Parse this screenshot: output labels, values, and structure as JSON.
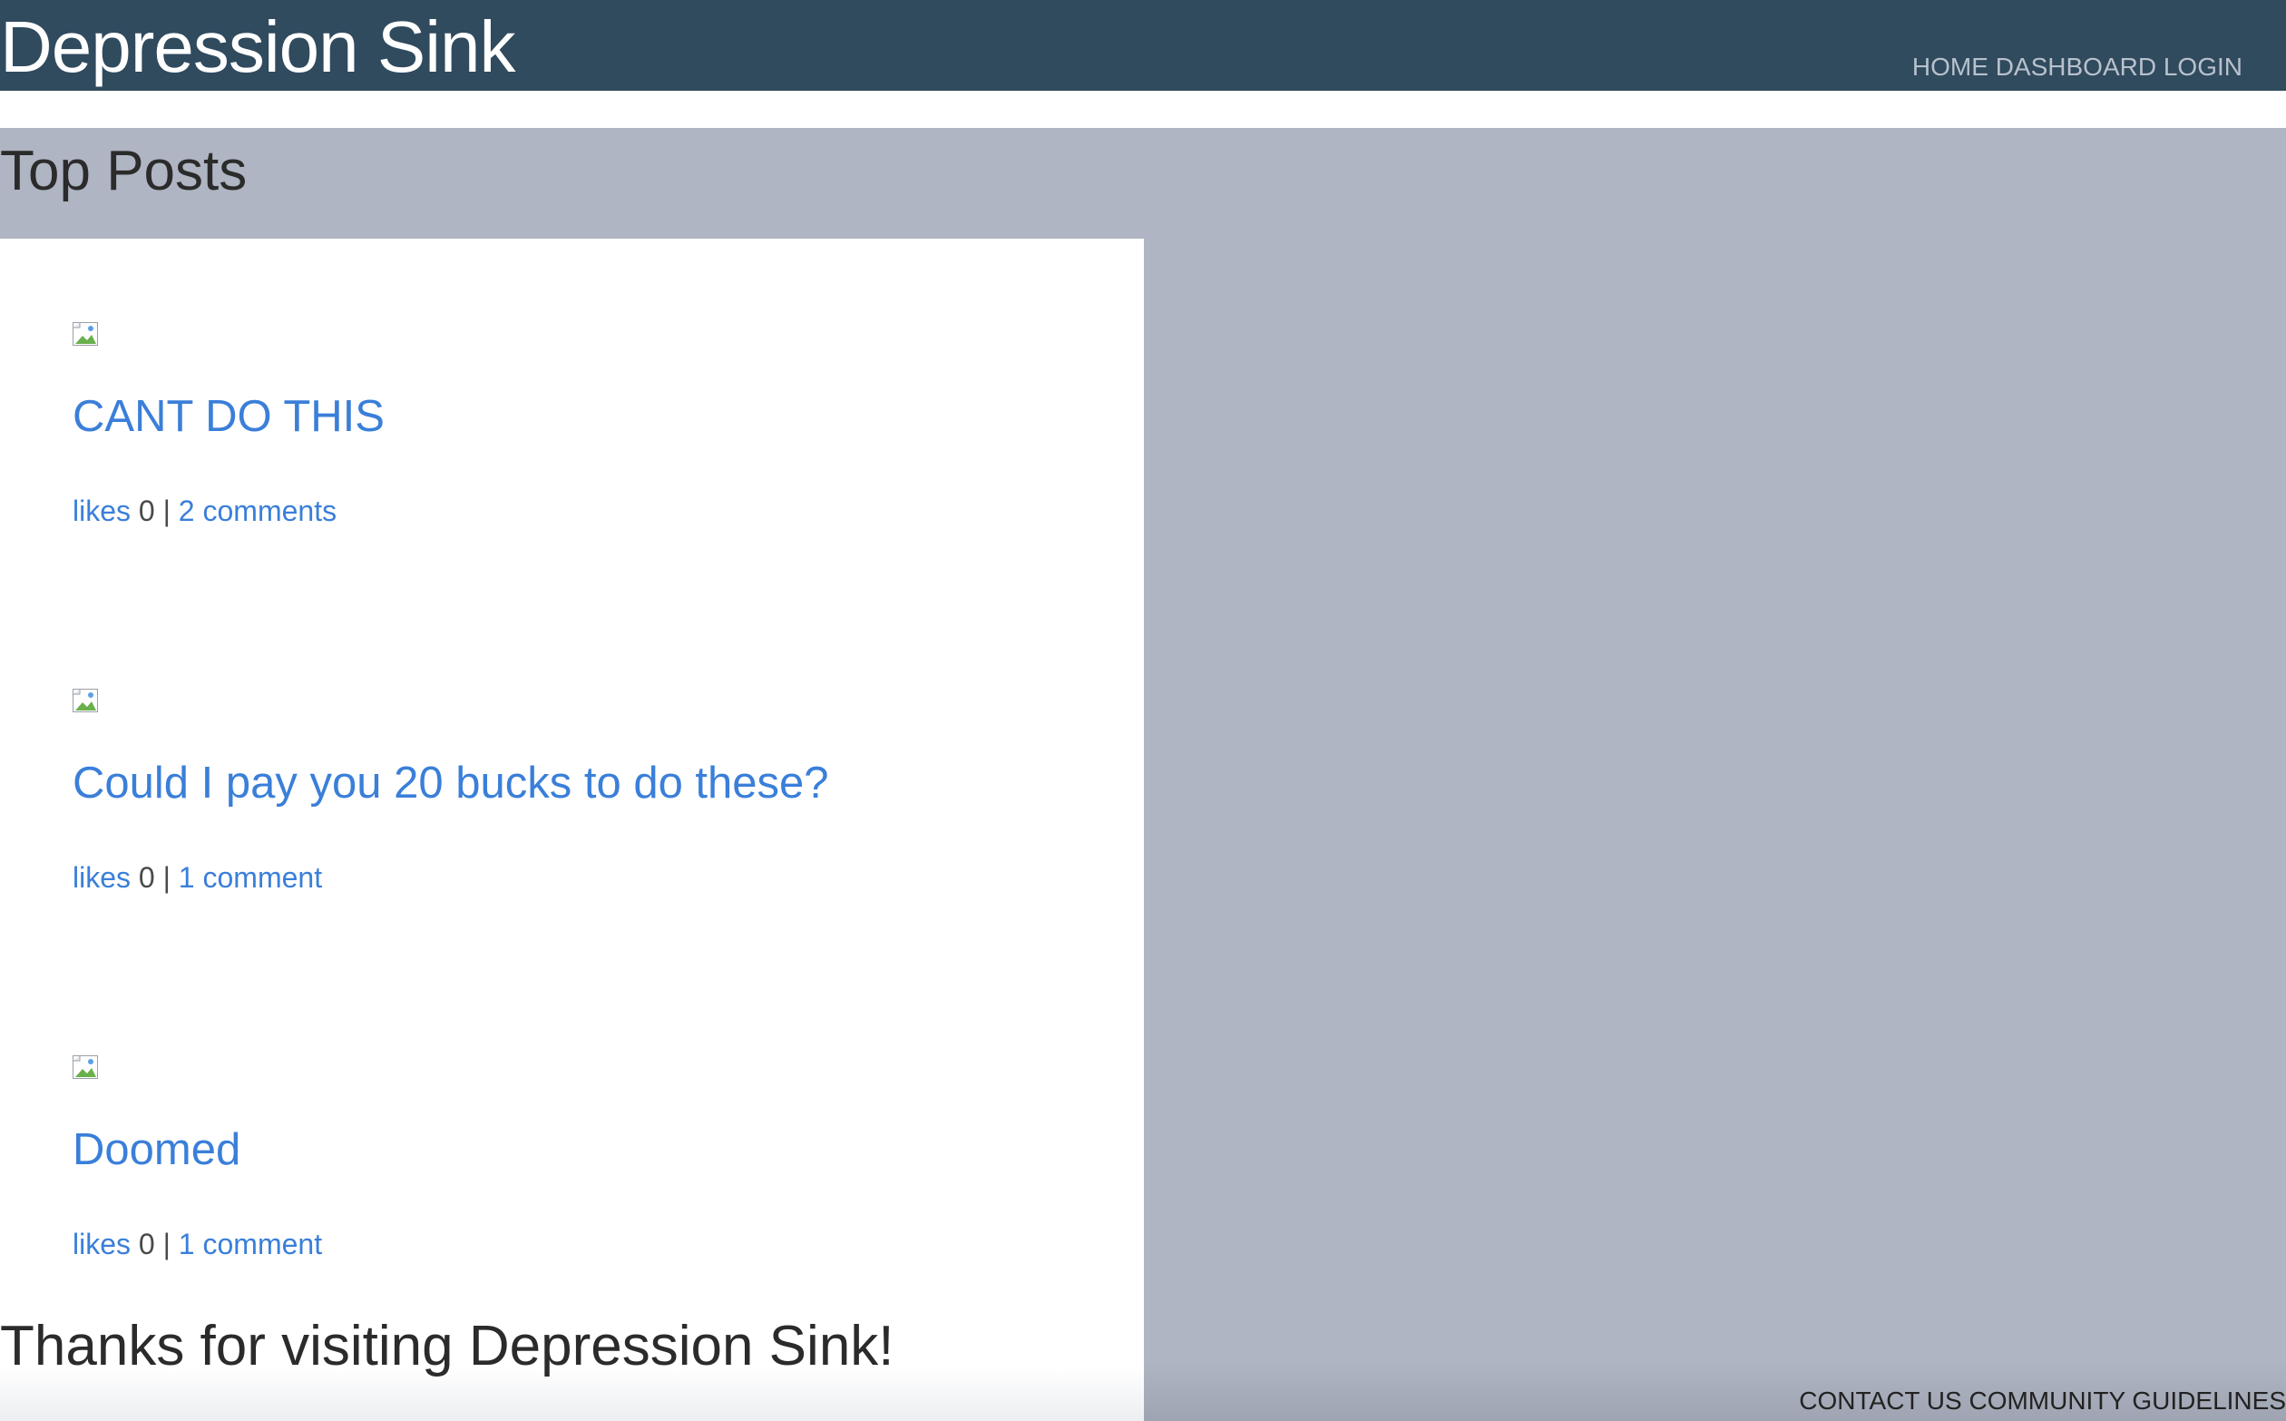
{
  "header": {
    "site_title": "Depression Sink",
    "nav": [
      "HOME",
      "DASHBOARD",
      "LOGIN"
    ]
  },
  "main": {
    "section_title": "Top Posts",
    "posts": [
      {
        "title": "CANT DO THIS",
        "likes_label": "likes",
        "likes_count": "0",
        "separator": "|",
        "comments_label": "2 comments",
        "thumbnail_icon": "broken-image-icon"
      },
      {
        "title": "Could I pay you 20 bucks to do these?",
        "likes_label": "likes",
        "likes_count": "0",
        "separator": "|",
        "comments_label": "1 comment",
        "thumbnail_icon": "broken-image-icon"
      },
      {
        "title": "Doomed",
        "likes_label": "likes",
        "likes_count": "0",
        "separator": "|",
        "comments_label": "1 comment",
        "thumbnail_icon": "broken-image-icon"
      }
    ]
  },
  "footer": {
    "thanks": "Thanks for visiting Depression Sink!",
    "links": [
      "CONTACT US",
      "COMMUNITY GUIDELINES"
    ]
  },
  "colors": {
    "header_bg": "#304a5e",
    "main_bg": "#afb5c2",
    "link": "#3a7fd9"
  }
}
